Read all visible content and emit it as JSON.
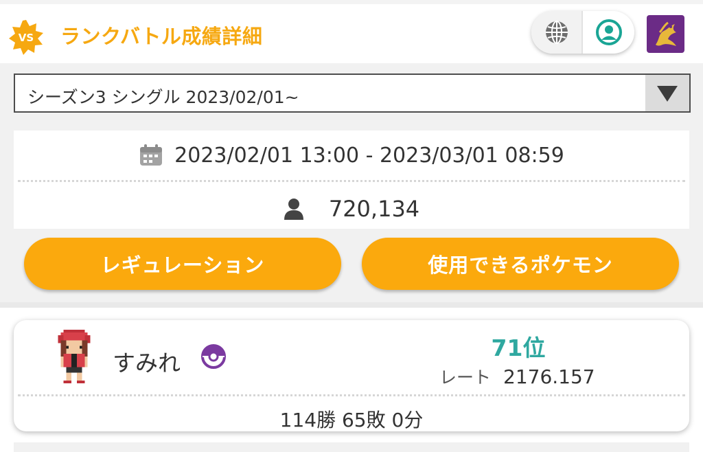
{
  "header": {
    "badge_text": "VS",
    "title": "ランクバトル成績詳細",
    "icons": [
      "globe-icon",
      "account-icon",
      "dragon-emblem-icon"
    ],
    "accent_color": "#f6a811"
  },
  "season_select": {
    "selected": "シーズン3 シングル 2023/02/01~"
  },
  "season_info": {
    "period": "2023/02/01 13:00 - 2023/03/01 08:59",
    "participants": "720,134"
  },
  "buttons": {
    "regulation": "レギュレーション",
    "usable_pokemon": "使用できるポケモン"
  },
  "player": {
    "name": "すみれ",
    "rank": "71位",
    "rate_label": "レート",
    "rate": "2176.157",
    "record": "114勝 65敗 0分"
  }
}
